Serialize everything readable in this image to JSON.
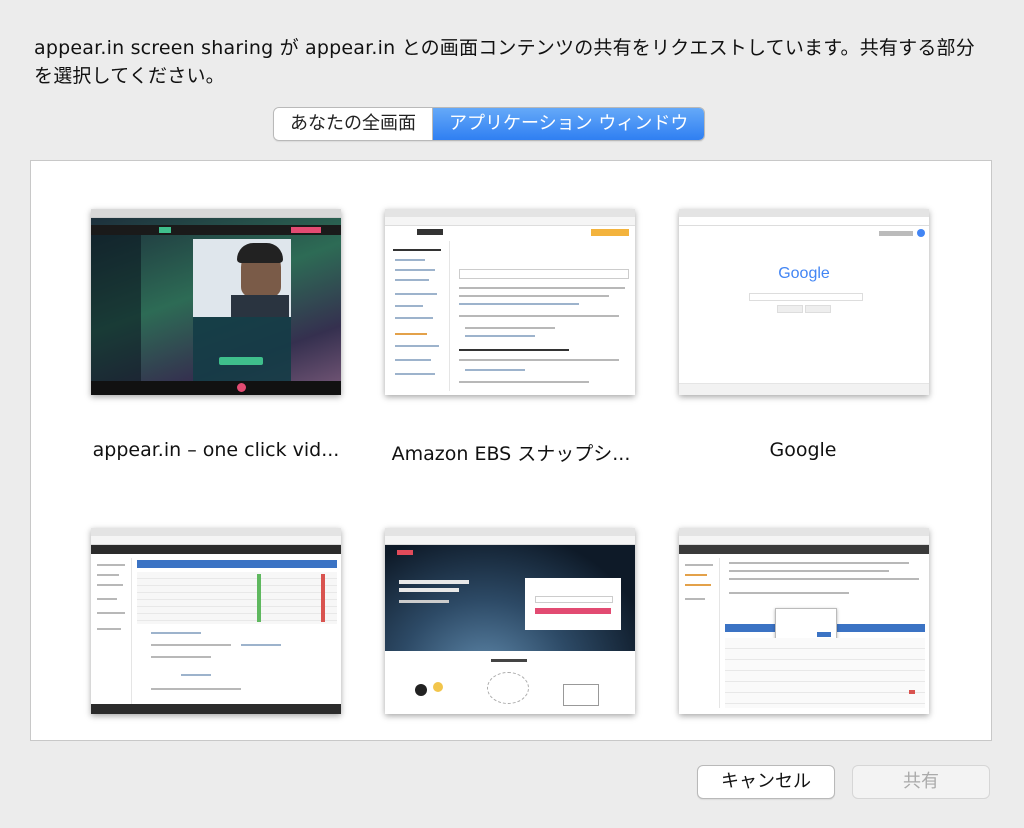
{
  "prompt": "appear.in screen sharing が appear.in との画面コンテンツの共有をリクエストしています。共有する部分を選択してください。",
  "segmented": {
    "options": [
      "あなたの全画面",
      "アプリケーション ウィンドウ"
    ],
    "selected": "アプリケーション ウィンドウ"
  },
  "windows": [
    {
      "title": "appear.in – one click vid..."
    },
    {
      "title": "Amazon EBS スナップシ..."
    },
    {
      "title": "Google"
    },
    {
      "title": ""
    },
    {
      "title": ""
    },
    {
      "title": ""
    }
  ],
  "thumb_text": {
    "google_logo": "Google"
  },
  "buttons": {
    "cancel": "キャンセル",
    "share": "共有"
  }
}
